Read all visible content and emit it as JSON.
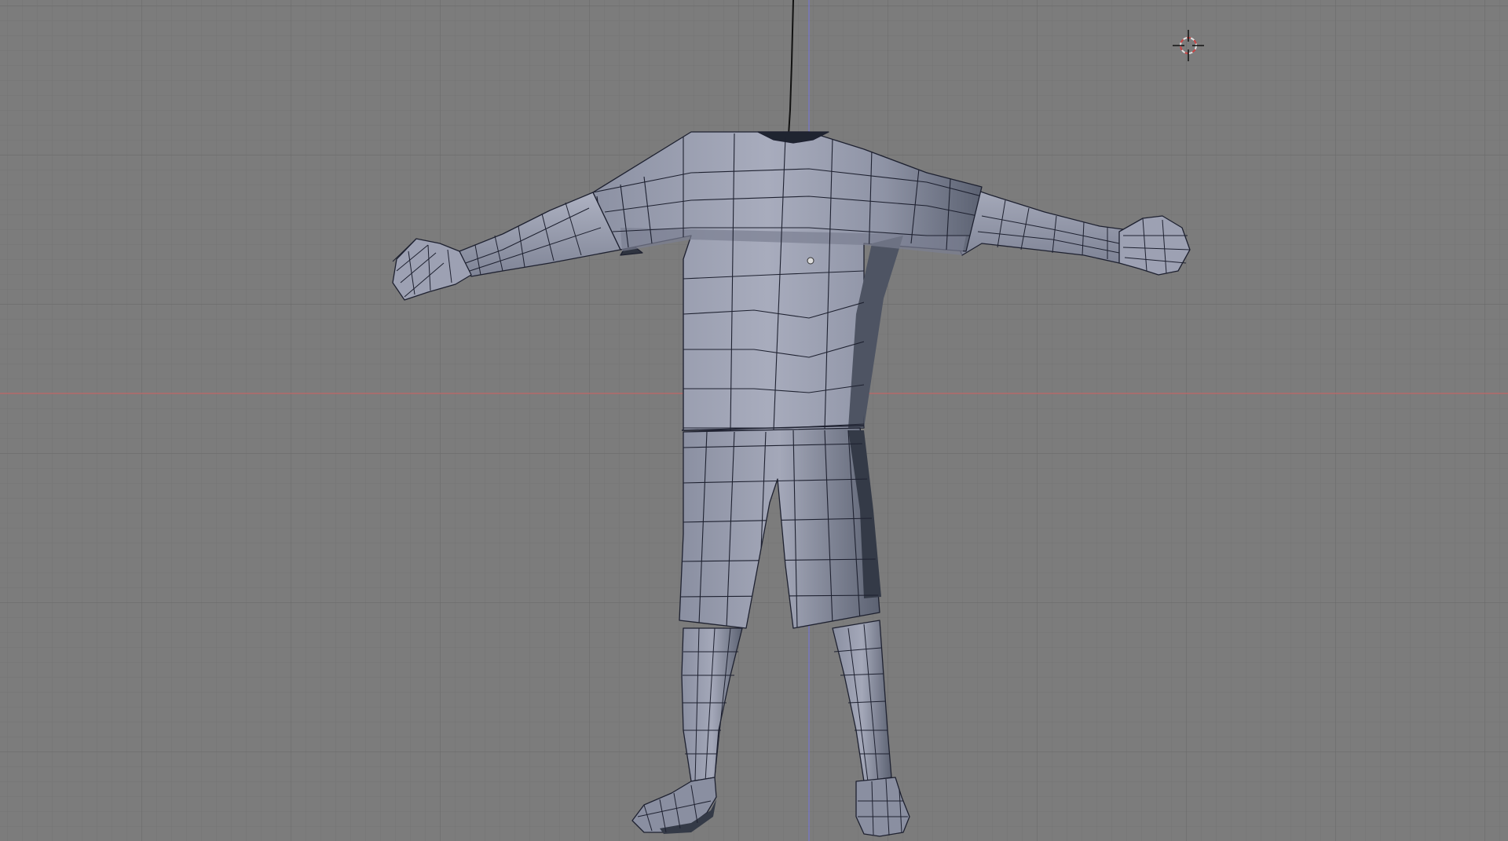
{
  "viewport": {
    "view_type": "3d-viewport-front-orthographic",
    "display_mode": "solid-wireframe-overlay",
    "mode": "edit-mode",
    "grid_visible": true
  },
  "colors": {
    "background": "#7c7c7c",
    "grid_minor": "#727272",
    "grid_major": "#666666",
    "x_axis": "#b56b6b",
    "z_axis": "#7b7bc0",
    "mesh_light": "#a3a7b8",
    "mesh_mid": "#8b90a2",
    "mesh_dark": "#5f6575",
    "mesh_shadow": "#343a47",
    "wire": "#1c1c2a",
    "vertex": "#c493c4"
  },
  "objects": [
    {
      "name": "character-body-mesh",
      "type": "mesh",
      "parts": [
        "shirt",
        "shorts",
        "left-arm",
        "right-arm",
        "left-hand",
        "right-hand",
        "left-leg",
        "right-leg",
        "left-foot",
        "right-foot"
      ]
    }
  ],
  "icons": {
    "cursor": "3d-cursor-icon",
    "origin": "object-origin-dot"
  }
}
